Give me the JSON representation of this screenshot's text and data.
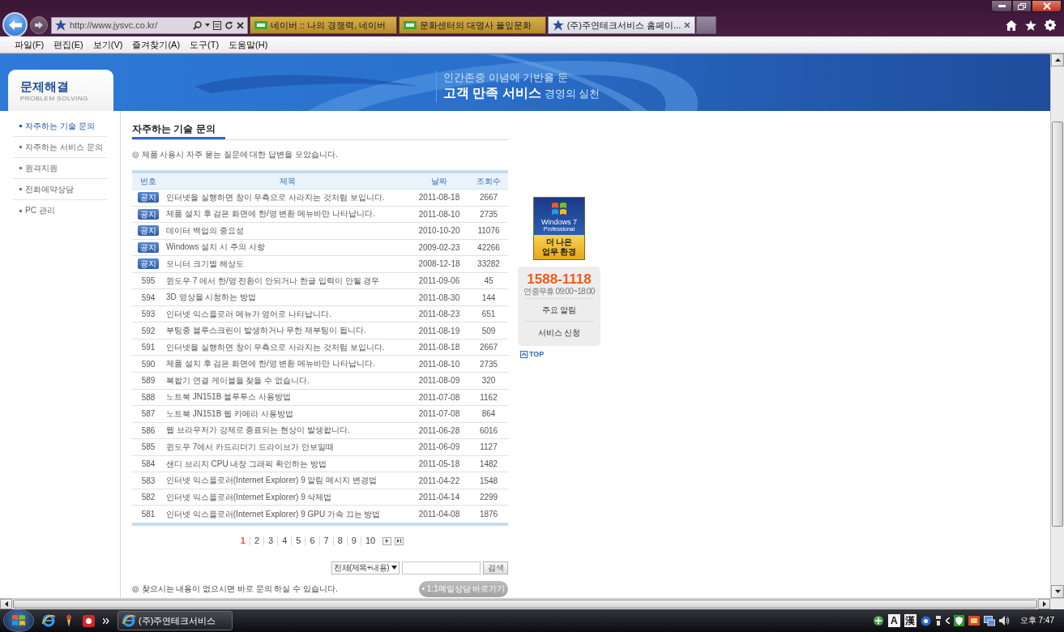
{
  "browser": {
    "address": "http://www.jysvc.co.kr/",
    "tabs": [
      {
        "title": "네이버 :: 나의 경쟁력, 네이버",
        "kind": "square",
        "selected": false
      },
      {
        "title": "문화센터의 대명사 풀잎문화",
        "kind": "square",
        "selected": false
      },
      {
        "title": "(주)주연테크서비스 홈페이...",
        "kind": "figure",
        "selected": true
      }
    ]
  },
  "menu_bar": {
    "items": [
      "파일(F)",
      "편집(E)",
      "보기(V)",
      "즐겨찾기(A)",
      "도구(T)",
      "도움말(H)"
    ]
  },
  "page": {
    "section_card": {
      "title": "문제해결",
      "subtitle": "PROBLEM SOLVING"
    },
    "banner": {
      "line_1": "인간존중 이념에 기반을 둔",
      "line_2": "**고객 만족 서비스** 경영의 실천"
    },
    "sidebar": {
      "items": [
        {
          "label": "자주하는 기술 문의",
          "selected": true
        },
        {
          "label": "자주하는 서비스 문의",
          "selected": false
        },
        {
          "label": "원격지원",
          "selected": false
        },
        {
          "label": "전화예약상담",
          "selected": false
        },
        {
          "label": "PC 관리",
          "selected": false
        }
      ]
    },
    "content": {
      "title": "자주하는 기술 문의",
      "description": "◎ 제품 사용시 자주 묻는 질문에 대한 답변을 모았습니다.",
      "table": {
        "columns": [
          "번호",
          "제목",
          "날짜",
          "조회수"
        ],
        "rows": [
          {
            "kind": "notice",
            "badge": "공지",
            "title": "인터넷을 실행하면 창이 우측으로 사라지는 것처럼 보입니다.",
            "date": "2011-08-18",
            "views": "2667"
          },
          {
            "kind": "notice",
            "badge": "공지",
            "title": "제품 설치 후 검은 화면에 한/영 변환 메뉴바만 나타납니다.",
            "date": "2011-08-10",
            "views": "2735"
          },
          {
            "kind": "notice",
            "badge": "공지",
            "title": "데이터 백업의 중요성",
            "date": "2010-10-20",
            "views": "11076"
          },
          {
            "kind": "notice",
            "badge": "공지",
            "title": "Windows 설치 시 주의 사항",
            "date": "2009-02-23",
            "views": "42266"
          },
          {
            "kind": "notice",
            "badge": "공지",
            "title": "모니터 크기별 해상도",
            "date": "2008-12-18",
            "views": "33282"
          },
          {
            "kind": "post",
            "number": "595",
            "title": "윈도우 7 에서 한/영 전환이 안되거나 한글 입력이 안될 경우",
            "date": "2011-09-06",
            "views": "45"
          },
          {
            "kind": "post",
            "number": "594",
            "title": "3D 영상을 시청하는 방법",
            "date": "2011-08-30",
            "views": "144"
          },
          {
            "kind": "post",
            "number": "593",
            "title": "인터넷 익스플로러 메뉴가 영어로 나타납니다.",
            "date": "2011-08-23",
            "views": "651"
          },
          {
            "kind": "post",
            "number": "592",
            "title": "부팅중 블루스크린이 발생하거나 무한 재부팅이 됩니다.",
            "date": "2011-08-19",
            "views": "509"
          },
          {
            "kind": "post",
            "number": "591",
            "title": "인터넷을 실행하면 창이 우측으로 사라지는 것처럼 보입니다.",
            "date": "2011-08-18",
            "views": "2667"
          },
          {
            "kind": "post",
            "number": "590",
            "title": "제품 설치 후 검은 화면에 한/영 변환 메뉴바만 나타납니다.",
            "date": "2011-08-10",
            "views": "2735"
          },
          {
            "kind": "post",
            "number": "589",
            "title": "복합기 연결 케이블을 찾을 수 없습니다.",
            "date": "2011-08-09",
            "views": "320"
          },
          {
            "kind": "post",
            "number": "588",
            "title": "노트북 JN151B 블루투스 사용방법",
            "date": "2011-07-08",
            "views": "1162"
          },
          {
            "kind": "post",
            "number": "587",
            "title": "노트북 JN151B 웹 카메라 사용방법",
            "date": "2011-07-08",
            "views": "864"
          },
          {
            "kind": "post",
            "number": "586",
            "title": "웹 브라우저가 강제로 종료되는 현상이 발생합니다.",
            "date": "2011-06-28",
            "views": "6016"
          },
          {
            "kind": "post",
            "number": "585",
            "title": "윈도우 7에서 카드리더기 드라이브가 안보일때",
            "date": "2011-06-09",
            "views": "1127"
          },
          {
            "kind": "post",
            "number": "584",
            "title": "샌디 브리지 CPU 내장 그래픽 확인하는 방법",
            "date": "2011-05-18",
            "views": "1482"
          },
          {
            "kind": "post",
            "number": "583",
            "title": "인터넷 익스플로러(Internet Explorer) 9 알림 메시지 변경법",
            "date": "2011-04-22",
            "views": "1548"
          },
          {
            "kind": "post",
            "number": "582",
            "title": "인터넷 익스플로러(Internet Explorer) 9 삭제법",
            "date": "2011-04-14",
            "views": "2299"
          },
          {
            "kind": "post",
            "number": "581",
            "title": "인터넷 익스플로러(Internet Explorer) 9 GPU 가속 끄는 방법",
            "date": "2011-04-08",
            "views": "1876"
          }
        ]
      },
      "pagination": {
        "pages": [
          {
            "label": "1",
            "selected": true
          },
          {
            "label": "2",
            "selected": false
          },
          {
            "label": "3",
            "selected": false
          },
          {
            "label": "4",
            "selected": false
          },
          {
            "label": "5",
            "selected": false
          },
          {
            "label": "6",
            "selected": false
          },
          {
            "label": "7",
            "selected": false
          },
          {
            "label": "8",
            "selected": false
          },
          {
            "label": "9",
            "selected": false
          },
          {
            "label": "10",
            "selected": false
          }
        ]
      },
      "search": {
        "scope": "전체(제목+내용)",
        "button": "검색"
      },
      "footer_note": "◎ 찾으시는 내용이 없으시면 바로 문의 하실 수 있습니다.",
      "contact_button": "• 1:1메일상담 바로가기"
    },
    "promo": {
      "title": "Windows 7",
      "subtitle": "Professional",
      "slogan": [
        "더 나은",
        "업무 환경"
      ]
    },
    "contact": {
      "phone": "1588-1118",
      "hours": "연중무휴 09:00~18:00",
      "links": [
        "주요 알림",
        "서비스 신청"
      ]
    },
    "top_link": "TOP"
  },
  "taskbar": {
    "window_button": "(주)주연테크서비스",
    "ime": [
      "A",
      "漢"
    ],
    "clock": "오후 7:47"
  }
}
